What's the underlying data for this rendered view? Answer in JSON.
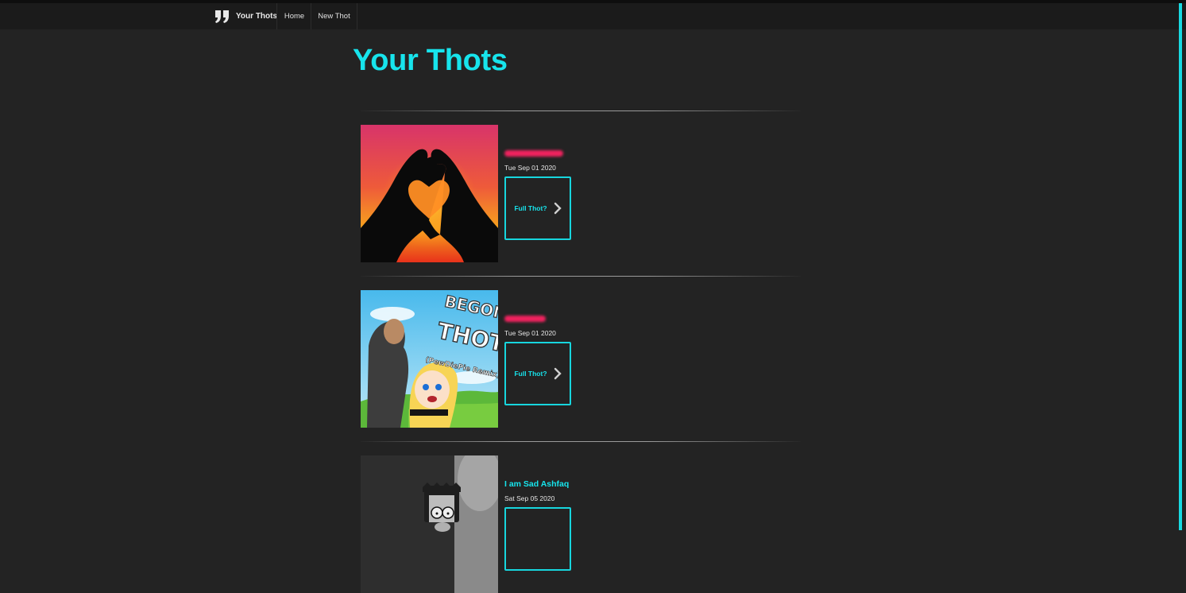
{
  "nav": {
    "brand_icon": "quote-icon",
    "brand": "Your Thots",
    "links": [
      "Home",
      "New Thot"
    ]
  },
  "page": {
    "title": "Your Thots"
  },
  "thots": [
    {
      "title": "",
      "title_redacted": true,
      "date": "Tue Sep 01 2020",
      "button": "Full Thot?",
      "image": "heart-hands-sunset"
    },
    {
      "title": "",
      "title_redacted": true,
      "date": "Tue Sep 01 2020",
      "button": "Full Thot?",
      "image": "begone-thot-thumbnail"
    },
    {
      "title": "I am Sad Ashfaq",
      "title_redacted": false,
      "date": "Sat Sep 05 2020",
      "button": "",
      "image": "grayscale-cartoon"
    }
  ],
  "colors": {
    "background": "#232323",
    "navbar": "#1b1b1b",
    "accent": "#17e4ec",
    "redaction": "#f0235f"
  },
  "thumbnail_text": {
    "begone": "BEGONE",
    "thot": "THOT!",
    "remix": "(PewDiePie Remix)"
  }
}
